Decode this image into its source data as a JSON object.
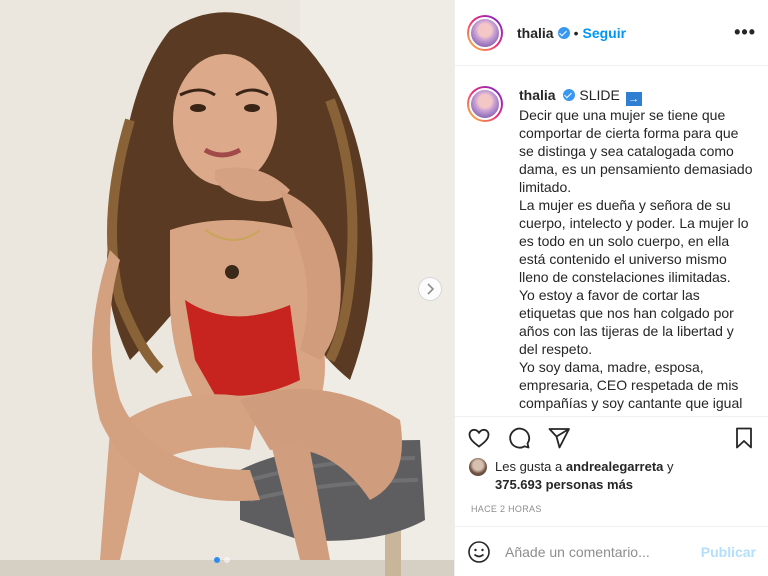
{
  "header": {
    "username": "thalia",
    "separator": "•",
    "follow_label": "Seguir",
    "more_label": "•••"
  },
  "caption": {
    "username": "thalia",
    "lead": "SLIDE",
    "slide_icon": "→",
    "text": "Decir que una mujer se tiene que comportar de cierta forma para que se distinga y sea catalogada como dama, es un pensamiento demasiado limitado.\nLa mujer es dueña y señora de su cuerpo, intelecto y poder. La mujer lo es todo en un solo cuerpo, en ella está contenido el universo mismo lleno de constelaciones ilimitadas.\nYo estoy a favor de cortar las etiquetas que nos han colgado por años con las tijeras de la libertad y del respeto.\nYo soy dama, madre, esposa, empresaria, CEO respetada de mis compañías y soy cantante que igual puede interpretar canciones de amor y"
  },
  "likes": {
    "prefix": "Les gusta a",
    "user": "andrealegarreta",
    "conj": "y",
    "count": "375.693 personas más"
  },
  "time": "HACE 2 HORAS",
  "comment": {
    "placeholder": "Añade un comentario...",
    "publish_label": "Publicar"
  },
  "icons": [
    "verified-icon",
    "heart-icon",
    "comment-icon",
    "share-icon",
    "bookmark-icon",
    "emoji-icon",
    "chevron-right-icon"
  ],
  "colors": {
    "accent": "#0095f6",
    "publish_disabled": "#b2dffc",
    "text": "#262626",
    "muted": "#8e8e8e"
  },
  "carousel": {
    "count": 2,
    "active": 1
  }
}
